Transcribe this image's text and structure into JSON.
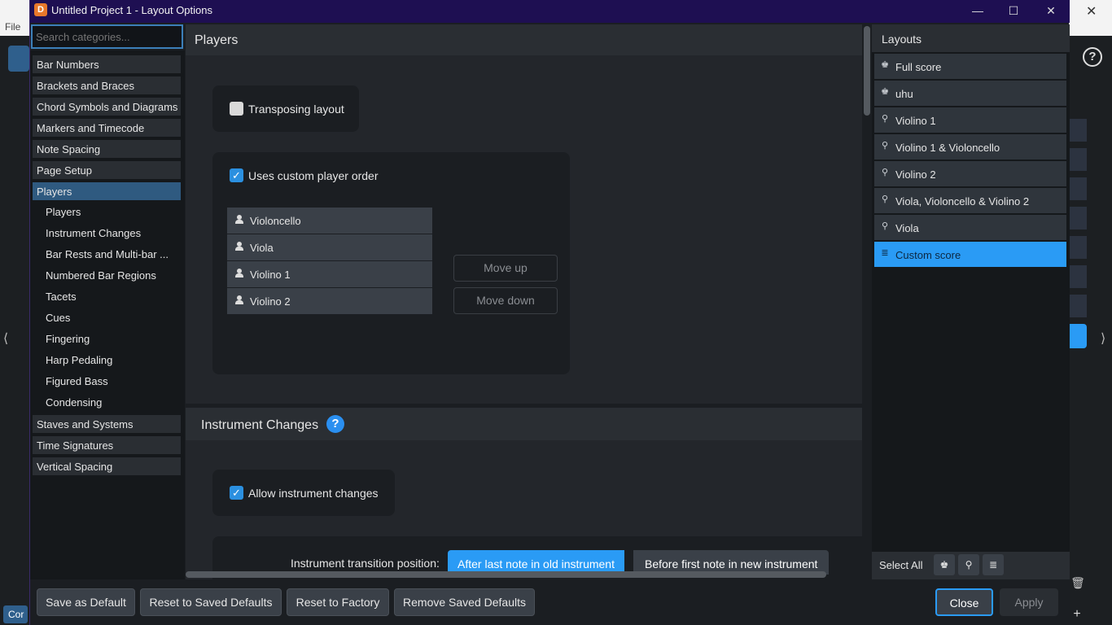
{
  "background": {
    "menu_file": "File",
    "bottom_left_label": "Cor",
    "help_glyph": "?",
    "chevron_left": "⟨",
    "chevron_right": "⟩",
    "close_glyph": "✕"
  },
  "window": {
    "title": "Untitled Project 1 - Layout Options",
    "app_icon": "D",
    "minimize": "—",
    "maximize": "☐",
    "close": "✕"
  },
  "search": {
    "placeholder": "Search categories..."
  },
  "categories": [
    {
      "label": "Bar Numbers"
    },
    {
      "label": "Brackets and Braces"
    },
    {
      "label": "Chord Symbols and Diagrams"
    },
    {
      "label": "Markers and Timecode"
    },
    {
      "label": "Note Spacing"
    },
    {
      "label": "Page Setup"
    },
    {
      "label": "Players"
    },
    {
      "label": "Staves and Systems"
    },
    {
      "label": "Time Signatures"
    },
    {
      "label": "Vertical Spacing"
    }
  ],
  "selected_category": "Players",
  "subcategories": [
    {
      "label": "Players"
    },
    {
      "label": "Instrument Changes"
    },
    {
      "label": "Bar Rests and Multi-bar ..."
    },
    {
      "label": "Numbered Bar Regions"
    },
    {
      "label": "Tacets"
    },
    {
      "label": "Cues"
    },
    {
      "label": "Fingering"
    },
    {
      "label": "Harp Pedaling"
    },
    {
      "label": "Figured Bass"
    },
    {
      "label": "Condensing"
    }
  ],
  "players_section": {
    "title": "Players",
    "transposing_layout": {
      "label": "Transposing layout",
      "checked": false
    },
    "custom_order": {
      "label": "Uses custom player order",
      "checked": true,
      "check_glyph": "✓"
    },
    "player_list": [
      {
        "name": "Violoncello"
      },
      {
        "name": "Viola"
      },
      {
        "name": "Violino 1"
      },
      {
        "name": "Violino 2"
      }
    ],
    "move_up": "Move up",
    "move_down": "Move down"
  },
  "instrument_changes_section": {
    "title": "Instrument Changes",
    "help_glyph": "?",
    "allow_changes": {
      "label": "Allow instrument changes",
      "checked": true,
      "check_glyph": "✓"
    },
    "transition_label": "Instrument transition position:",
    "options": [
      "After last note in old instrument",
      "Before first note in new instrument"
    ],
    "selected_option": "After last note in old instrument"
  },
  "layouts": {
    "title": "Layouts",
    "items": [
      {
        "label": "Full score",
        "icon": "full-score-icon",
        "glyph": "♚"
      },
      {
        "label": "uhu",
        "icon": "full-score-icon",
        "glyph": "♚"
      },
      {
        "label": "Violino 1",
        "icon": "part-icon",
        "glyph": "⚲"
      },
      {
        "label": "Violino 1 & Violoncello",
        "icon": "part-icon",
        "glyph": "⚲"
      },
      {
        "label": "Violino 2",
        "icon": "part-icon",
        "glyph": "⚲"
      },
      {
        "label": "Viola, Violoncello & Violino 2",
        "icon": "part-icon",
        "glyph": "⚲"
      },
      {
        "label": "Viola",
        "icon": "part-icon",
        "glyph": "⚲"
      },
      {
        "label": "Custom score",
        "icon": "custom-score-icon",
        "glyph": "≣"
      }
    ],
    "selected": "Custom score",
    "select_all": "Select All",
    "footer_icons": [
      {
        "name": "full-score-icon",
        "glyph": "♚"
      },
      {
        "name": "part-icon",
        "glyph": "⚲"
      },
      {
        "name": "custom-score-icon",
        "glyph": "≣"
      }
    ]
  },
  "footer": {
    "save_default": "Save as Default",
    "reset_saved": "Reset to Saved Defaults",
    "reset_factory": "Reset to Factory",
    "remove_saved": "Remove Saved Defaults",
    "close": "Close",
    "apply": "Apply"
  },
  "colors": {
    "accent": "#2a9bf5",
    "titlebar": "#1e0f52",
    "selected_category": "#2f5a80",
    "app_icon": "#e8782b"
  }
}
